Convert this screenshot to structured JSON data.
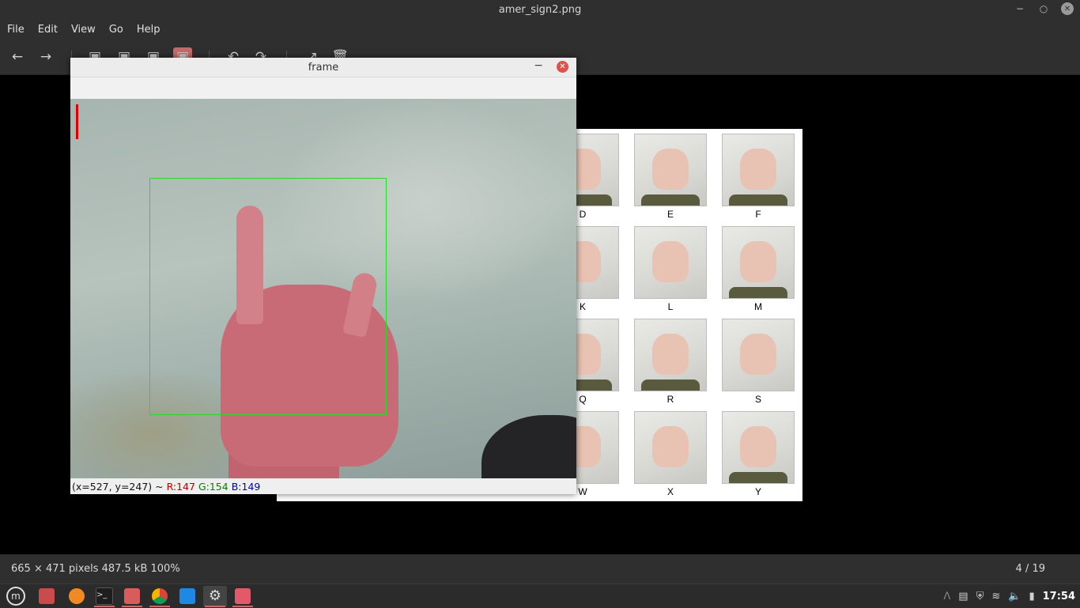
{
  "window": {
    "title": "amer_sign2.png"
  },
  "menu": [
    "File",
    "Edit",
    "View",
    "Go",
    "Help"
  ],
  "image": {
    "letters": [
      "D",
      "E",
      "F",
      "K",
      "L",
      "M",
      "Q",
      "R",
      "S",
      "W",
      "X",
      "Y"
    ]
  },
  "frame": {
    "title": "frame",
    "status_prefix": "(x=527, y=247) ~ ",
    "status_r": "R:147",
    "status_g": "G:154",
    "status_b": "B:149"
  },
  "statusbar": {
    "info": "665 × 471 pixels  487.5 kB   100%",
    "position": "4 / 19"
  },
  "taskbar": {
    "clock": "17:54",
    "colors": {
      "files": "#c94b4b",
      "firefox": "#f08a24",
      "terminal": "#1e1e1e",
      "folder": "#d95c5c",
      "chrome": "#4285f4",
      "vscode": "#1e88e5",
      "settings": "#9aa0a6",
      "viewer": "#e05a6a"
    }
  }
}
